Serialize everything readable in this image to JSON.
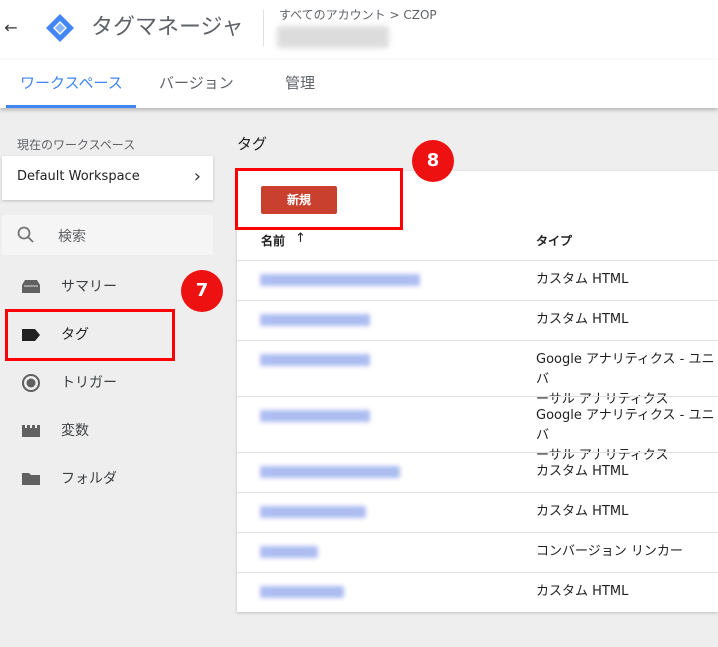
{
  "header": {
    "app_title": "タグマネージャ",
    "breadcrumb": "すべてのアカウント > CZOP",
    "back_icon": "arrow-left-icon",
    "logo": "gtm-logo-icon"
  },
  "tabs": [
    {
      "label": "ワークスペース",
      "active": true
    },
    {
      "label": "バージョン",
      "active": false
    },
    {
      "label": "管理",
      "active": false
    }
  ],
  "sidebar": {
    "workspace_label": "現在のワークスペース",
    "workspace_name": "Default Workspace",
    "search_placeholder": "検索",
    "items": [
      {
        "label": "サマリー",
        "icon": "summary-icon"
      },
      {
        "label": "タグ",
        "icon": "tag-icon",
        "active": true
      },
      {
        "label": "トリガー",
        "icon": "trigger-icon"
      },
      {
        "label": "変数",
        "icon": "variable-icon"
      },
      {
        "label": "フォルダ",
        "icon": "folder-icon"
      }
    ]
  },
  "annotations": {
    "badge_7": "7",
    "badge_8": "8",
    "highlight_color": "#ff0000"
  },
  "main": {
    "title": "タグ",
    "new_button": "新規",
    "columns": {
      "name": "名前",
      "sort_icon": "↑",
      "type": "タイプ"
    },
    "rows": [
      {
        "type": "カスタム HTML"
      },
      {
        "type": "カスタム HTML"
      },
      {
        "type": "Google アナリティクス - ユニバ\nーサル アナリティクス"
      },
      {
        "type": "Google アナリティクス - ユニバ\nーサル アナリティクス"
      },
      {
        "type": "カスタム HTML"
      },
      {
        "type": "カスタム HTML"
      },
      {
        "type": "コンバージョン リンカー"
      },
      {
        "type": "カスタム HTML"
      }
    ]
  },
  "colors": {
    "accent": "#4285f4",
    "new_button": "#c9402f",
    "badge": "#ee1111"
  }
}
